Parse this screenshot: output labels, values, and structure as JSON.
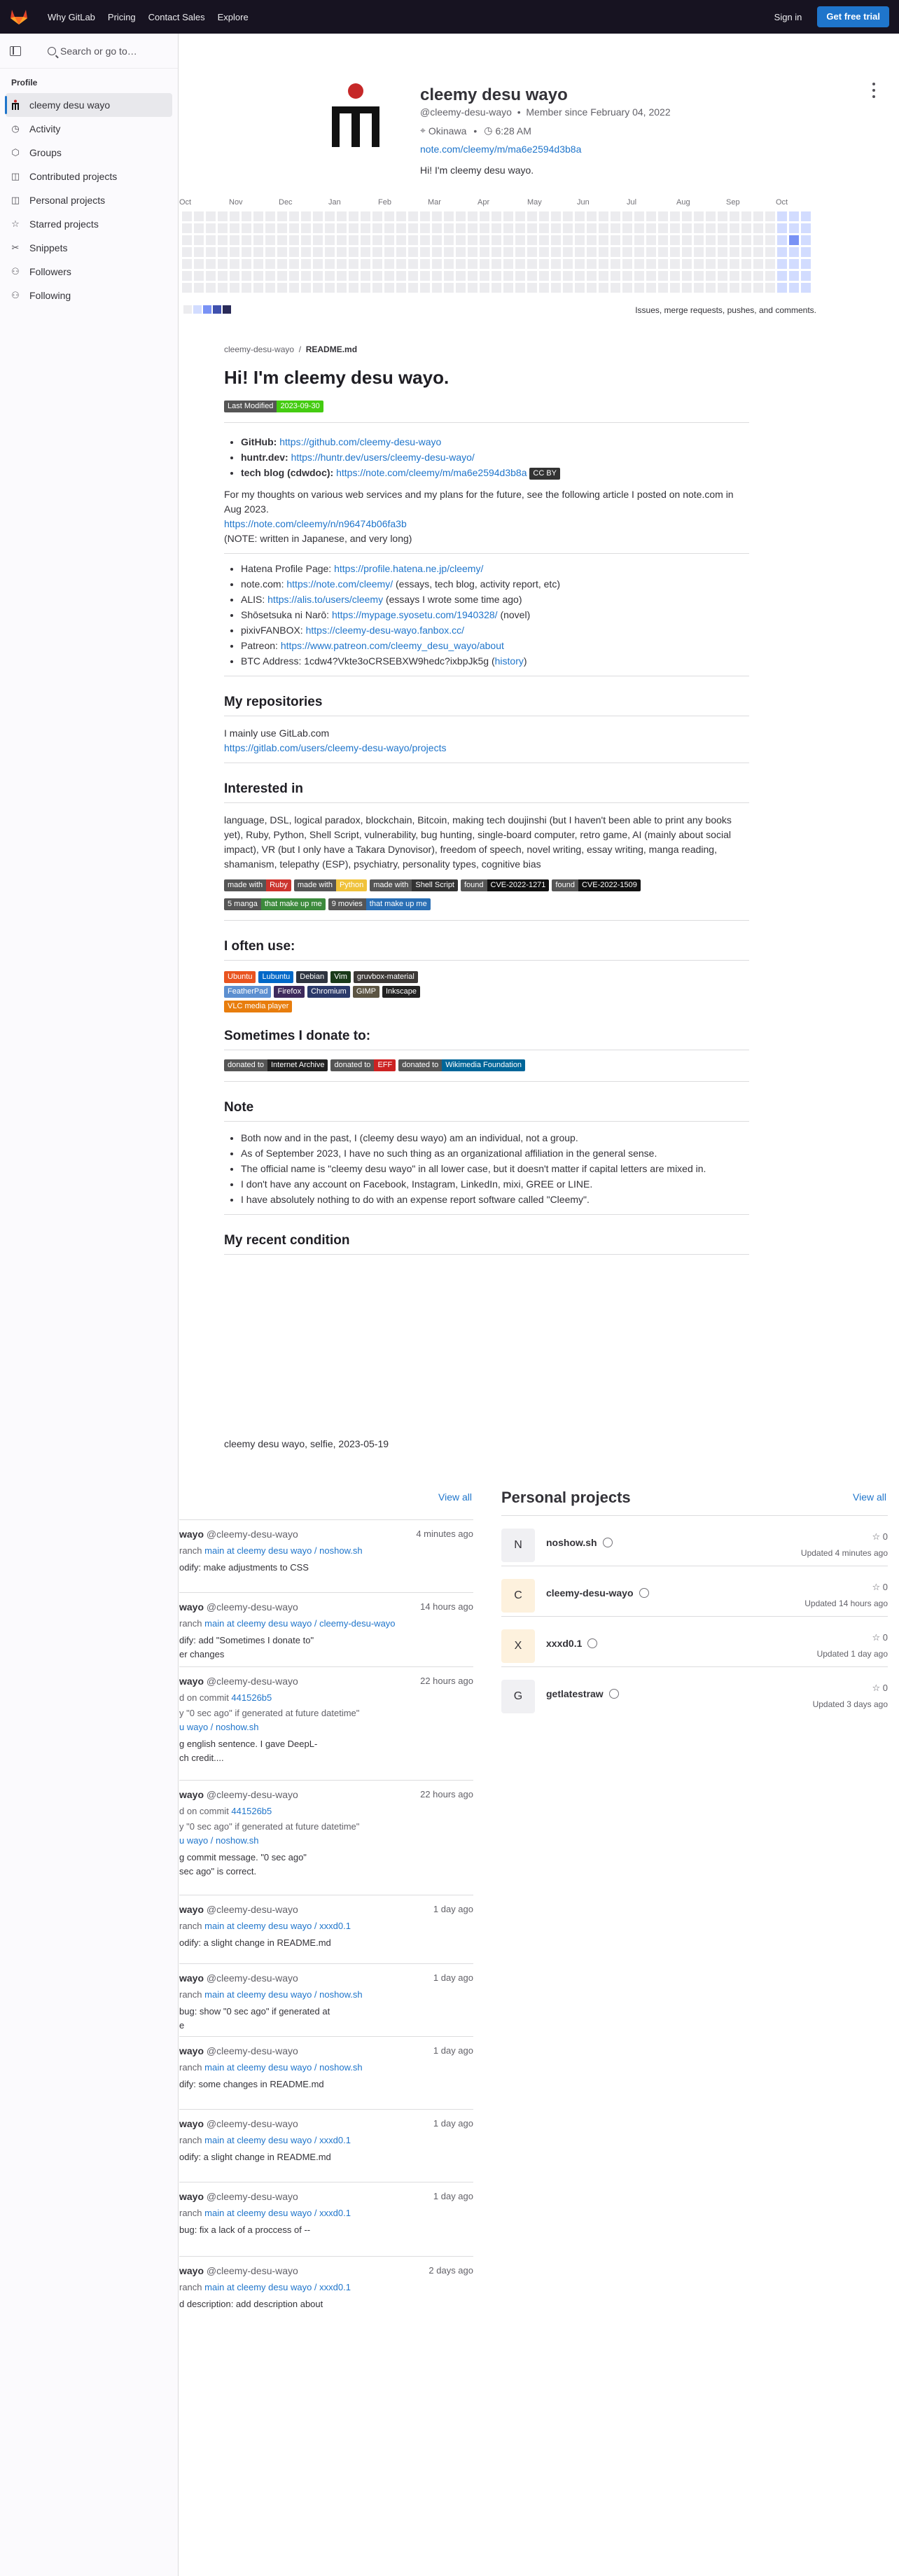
{
  "topbar": {
    "nav": [
      "Why GitLab",
      "Pricing",
      "Contact Sales",
      "Explore"
    ],
    "sign_in": "Sign in",
    "free_trial": "Get free trial"
  },
  "sidebar": {
    "search": "Search or go to…",
    "section": "Profile",
    "items": [
      {
        "label": "cleemy desu wayo",
        "icon": "avatar-icon"
      },
      {
        "label": "Activity",
        "icon": "history-icon"
      },
      {
        "label": "Groups",
        "icon": "group-icon"
      },
      {
        "label": "Contributed projects",
        "icon": "project-icon"
      },
      {
        "label": "Personal projects",
        "icon": "project-icon"
      },
      {
        "label": "Starred projects",
        "icon": "star-icon"
      },
      {
        "label": "Snippets",
        "icon": "snippet-icon"
      },
      {
        "label": "Followers",
        "icon": "users-icon"
      },
      {
        "label": "Following",
        "icon": "users-icon"
      }
    ]
  },
  "profile": {
    "name": "cleemy desu wayo",
    "handle": "@cleemy-desu-wayo",
    "member_since": "Member since February 04, 2022",
    "location": "Okinawa",
    "local_time": "6:28 AM",
    "url": "note.com/cleemy/m/ma6e2594d3b8a",
    "bio": "Hi! I'm cleemy desu wayo."
  },
  "calendar": {
    "months": [
      "Oct",
      "Nov",
      "Dec",
      "Jan",
      "Feb",
      "Mar",
      "Apr",
      "May",
      "Jun",
      "Jul",
      "Aug",
      "Sep",
      "Oct"
    ],
    "legend_colors": [
      "#ececef",
      "#d2dcff",
      "#7992f5",
      "#3f51ae",
      "#2a2b59"
    ],
    "note": "Issues, merge requests, pushes, and comments."
  },
  "readme": {
    "crumb_user": "cleemy-desu-wayo",
    "crumb_file": "README.md",
    "title": "Hi! I'm cleemy desu wayo.",
    "badge_last_modified": {
      "label": "Last Modified",
      "value": "2023-09-30"
    },
    "links": [
      {
        "k": "GitHub:",
        "v": "https://github.com/cleemy-desu-wayo"
      },
      {
        "k": "huntr.dev:",
        "v": "https://huntr.dev/users/cleemy-desu-wayo/"
      },
      {
        "k": "tech blog (cdwdoc):",
        "v": "https://note.com/cleemy/m/ma6e2594d3b8a",
        "badge": "CC BY"
      }
    ],
    "p1": "For my thoughts on various web services and my plans for the future, see the following article I posted on note.com in Aug 2023.",
    "p1_link": "https://note.com/cleemy/n/n96474b06fa3b",
    "p1_note": "(NOTE: written in Japanese, and very long)",
    "list2": [
      {
        "k": "Hatena Profile Page: ",
        "link": "https://profile.hatena.ne.jp/cleemy/",
        "rest": ""
      },
      {
        "k": "note.com: ",
        "link": "https://note.com/cleemy/",
        "rest": " (essays, tech blog, activity report, etc)"
      },
      {
        "k": "ALIS: ",
        "link": "https://alis.to/users/cleemy",
        "rest": " (essays I wrote some time ago)"
      },
      {
        "k": "Shōsetsuka ni Narō: ",
        "link": "https://mypage.syosetu.com/1940328/",
        "rest": " (novel)"
      },
      {
        "k": "pixivFANBOX: ",
        "link": "https://cleemy-desu-wayo.fanbox.cc/",
        "rest": ""
      },
      {
        "k": "Patreon: ",
        "link": "https://www.patreon.com/cleemy_desu_wayo/about",
        "rest": ""
      },
      {
        "k": "BTC Address: 1cdw4?Vkte3oCRSEBXW9hedc?ixbpJk5g (",
        "link": "history",
        "rest": ")"
      }
    ],
    "h_repos": "My repositories",
    "repos_text": "I mainly use GitLab.com",
    "repos_link": "https://gitlab.com/users/cleemy-desu-wayo/projects",
    "h_interest": "Interested in",
    "interest_text": "language, DSL, logical paradox, blockchain, Bitcoin, making tech doujinshi (but I haven't been able to print any books yet), Ruby, Python, Shell Script, vulnerability, bug hunting, single-board computer, retro game, AI (mainly about social impact), VR (but I only have a Takara Dynovisor), freedom of speech, novel writing, essay writing, manga reading, shamanism, telepathy (ESP), psychiatry, personality types, cognitive bias",
    "badges_lang": [
      {
        "l": "made with",
        "v": "Ruby",
        "c": "#cc342d"
      },
      {
        "l": "made with",
        "v": "Python",
        "c": "#f0c23a"
      },
      {
        "l": "made with",
        "v": "Shell Script",
        "c": "#333333"
      },
      {
        "l": "found",
        "v": "CVE-2022-1271",
        "c": "#111111"
      },
      {
        "l": "found",
        "v": "CVE-2022-1509",
        "c": "#111111"
      }
    ],
    "badges_media": [
      {
        "l": "5 manga",
        "v": "that make up me",
        "c": "#3c8a3c"
      },
      {
        "l": "9 movies",
        "v": "that make up me",
        "c": "#2a6fb5"
      }
    ],
    "h_use": "I often use:",
    "badges_use": [
      {
        "v": "Ubuntu",
        "c": "#e95420"
      },
      {
        "v": "Lubuntu",
        "c": "#0068c8"
      },
      {
        "v": "Debian",
        "c": "#2e3440"
      },
      {
        "v": "Vim",
        "c": "#1a3a1a"
      },
      {
        "v": "gruvbox-material",
        "c": "#3c3836"
      },
      {
        "v": "FeatherPad",
        "c": "#5c8fd0"
      },
      {
        "v": "Firefox",
        "c": "#3d2a5c"
      },
      {
        "v": "Chromium",
        "c": "#2b3a6a"
      },
      {
        "v": "GIMP",
        "c": "#5c5543"
      },
      {
        "v": "Inkscape",
        "c": "#222222"
      },
      {
        "v": "VLC media player",
        "c": "#e87d0d"
      }
    ],
    "h_donate": "Sometimes I donate to:",
    "badges_donate": [
      {
        "l": "donated to",
        "v": "Internet Archive",
        "c": "#222222"
      },
      {
        "l": "donated to",
        "v": "EFF",
        "c": "#cc2222"
      },
      {
        "l": "donated to",
        "v": "Wikimedia Foundation",
        "c": "#006699"
      }
    ],
    "h_note": "Note",
    "notes": [
      "Both now and in the past, I (cleemy desu wayo) am an individual, not a group.",
      "As of September 2023, I have no such thing as an organizational affiliation in the general sense.",
      "The official name is \"cleemy desu wayo\" in all lower case, but it doesn't matter if capital letters are mixed in.",
      "I don't have any account on Facebook, Instagram, LinkedIn, mixi, GREE or LINE.",
      "I have absolutely nothing to do with an expense report software called \"Cleemy\"."
    ],
    "h_condition": "My recent condition",
    "caption": "cleemy desu wayo, selfie, 2023-05-19"
  },
  "activity": {
    "view_all": "View all",
    "items": [
      {
        "who": "wayo",
        "handle": "@cleemy-desu-wayo",
        "time": "4 minutes ago",
        "l2": "ranch ",
        "l2a": "main at cleemy desu wayo / noshow.sh",
        "l3": "odify: make adjustments to CSS",
        "l4": "",
        "l5": ""
      },
      {
        "who": "wayo",
        "handle": "@cleemy-desu-wayo",
        "time": "14 hours ago",
        "l2": "ranch ",
        "l2a": "main at cleemy desu wayo / cleemy-desu-wayo",
        "l3": "dify: add \"Sometimes I donate to\"",
        "l4": "er changes",
        "l5": ""
      },
      {
        "who": "wayo",
        "handle": "@cleemy-desu-wayo",
        "time": "22 hours ago",
        "l2": "d on commit ",
        "l2a": "441526b5",
        "l3": "y \"0 sec ago\" if generated at future datetime\"",
        "l3a": "u wayo / noshow.sh",
        "l4": "g english sentence. I gave DeepL-",
        "l5": "ch credit...."
      },
      {
        "who": "wayo",
        "handle": "@cleemy-desu-wayo",
        "time": "22 hours ago",
        "l2": "d on commit ",
        "l2a": "441526b5",
        "l3": "y \"0 sec ago\" if generated at future datetime\"",
        "l3a": "u wayo / noshow.sh",
        "l4": "g commit message. \"0 sec ago\"",
        "l5": "sec ago\" is correct."
      },
      {
        "who": "wayo",
        "handle": "@cleemy-desu-wayo",
        "time": "1 day ago",
        "l2": "ranch ",
        "l2a": "main at cleemy desu wayo / xxxd0.1",
        "l3": "odify: a slight change in README.md",
        "l4": "",
        "l5": ""
      },
      {
        "who": "wayo",
        "handle": "@cleemy-desu-wayo",
        "time": "1 day ago",
        "l2": "ranch ",
        "l2a": "main at cleemy desu wayo / noshow.sh",
        "l3": " bug: show \"0 sec ago\" if generated at",
        "l4": "e",
        "l5": ""
      },
      {
        "who": "wayo",
        "handle": "@cleemy-desu-wayo",
        "time": "1 day ago",
        "l2": "ranch ",
        "l2a": "main at cleemy desu wayo / noshow.sh",
        "l3": "dify: some changes in README.md",
        "l4": "",
        "l5": ""
      },
      {
        "who": "wayo",
        "handle": "@cleemy-desu-wayo",
        "time": "1 day ago",
        "l2": "ranch ",
        "l2a": "main at cleemy desu wayo / xxxd0.1",
        "l3": "odify: a slight change in README.md",
        "l4": "",
        "l5": ""
      },
      {
        "who": "wayo",
        "handle": "@cleemy-desu-wayo",
        "time": "1 day ago",
        "l2": "ranch ",
        "l2a": "main at cleemy desu wayo / xxxd0.1",
        "l3": " bug: fix a lack of a proccess of --",
        "l4": "",
        "l5": ""
      },
      {
        "who": "wayo",
        "handle": "@cleemy-desu-wayo",
        "time": "2 days ago",
        "l2": "ranch ",
        "l2a": "main at cleemy desu wayo / xxxd0.1",
        "l3": "d description: add description about",
        "l4": "",
        "l5": ""
      }
    ]
  },
  "personal_projects": {
    "title": "Personal projects",
    "view_all": "View all",
    "items": [
      {
        "initial": "N",
        "name": "noshow.sh",
        "stars": "0",
        "updated": "Updated 4 minutes ago",
        "bg": "#f0f0f3"
      },
      {
        "initial": "C",
        "name": "cleemy-desu-wayo",
        "stars": "0",
        "updated": "Updated 14 hours ago",
        "bg": "#fdf1dd"
      },
      {
        "initial": "X",
        "name": "xxxd0.1",
        "stars": "0",
        "updated": "Updated 1 day ago",
        "bg": "#fdf1dd"
      },
      {
        "initial": "G",
        "name": "getlatestraw",
        "stars": "0",
        "updated": "Updated 3 days ago",
        "bg": "#f0f0f3"
      }
    ]
  }
}
